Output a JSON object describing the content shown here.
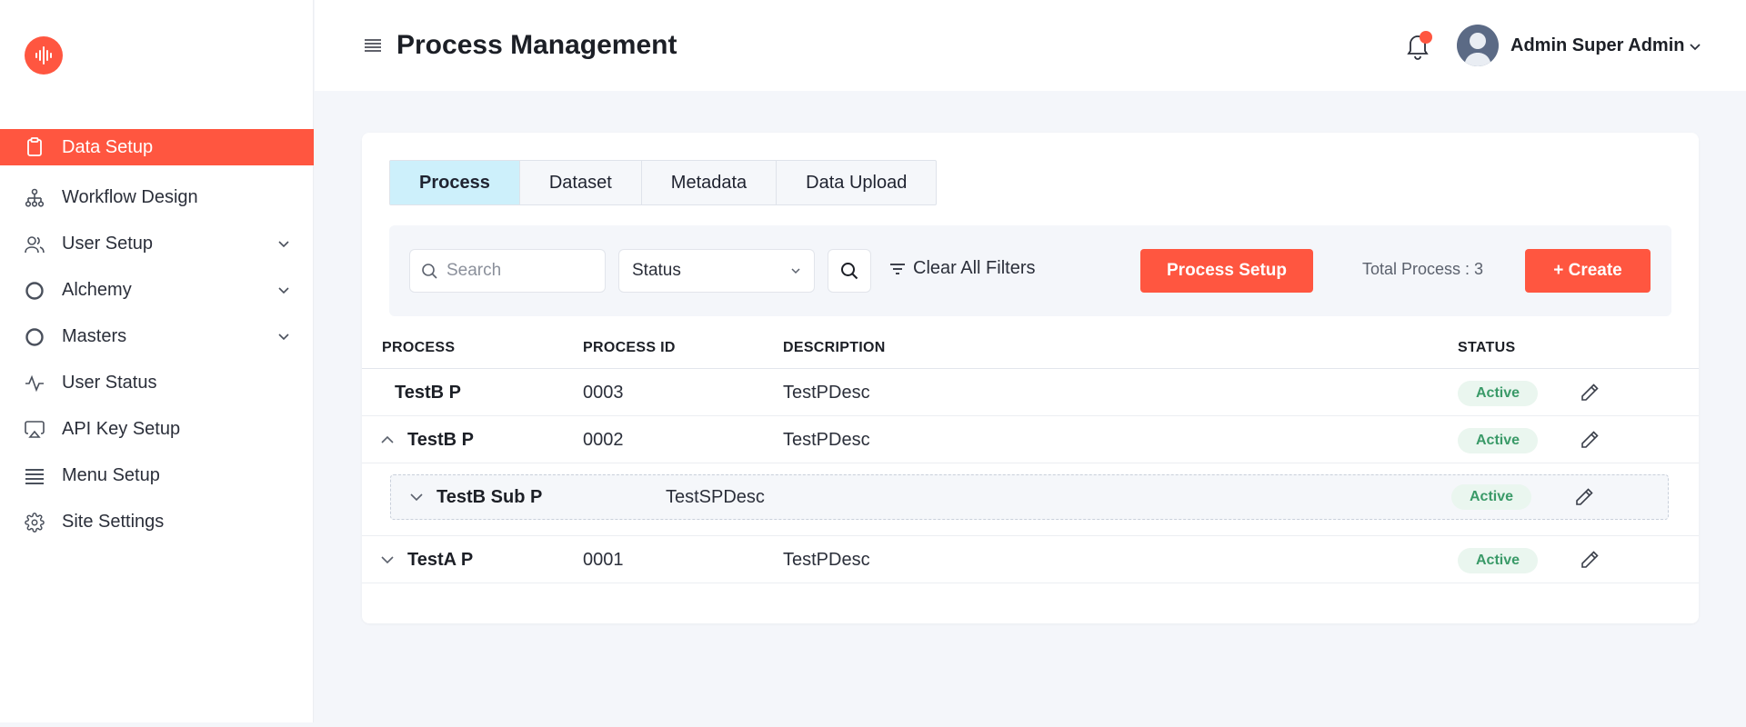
{
  "sidebar": {
    "items": [
      {
        "label": "Data Setup",
        "icon": "clipboard-icon",
        "active": true,
        "has_children": false
      },
      {
        "label": "Workflow Design",
        "icon": "hierarchy-icon",
        "active": false,
        "has_children": false
      },
      {
        "label": "User Setup",
        "icon": "users-icon",
        "active": false,
        "has_children": true
      },
      {
        "label": "Alchemy",
        "icon": "circle-icon",
        "active": false,
        "has_children": true
      },
      {
        "label": "Masters",
        "icon": "circle-icon",
        "active": false,
        "has_children": true
      },
      {
        "label": "User Status",
        "icon": "activity-icon",
        "active": false,
        "has_children": false
      },
      {
        "label": "API Key Setup",
        "icon": "airplay-icon",
        "active": false,
        "has_children": false
      },
      {
        "label": "Menu Setup",
        "icon": "list-icon",
        "active": false,
        "has_children": false
      },
      {
        "label": "Site Settings",
        "icon": "gear-icon",
        "active": false,
        "has_children": false
      }
    ]
  },
  "header": {
    "title": "Process Management",
    "user_name": "Admin Super Admin"
  },
  "tabs": [
    {
      "label": "Process",
      "active": true
    },
    {
      "label": "Dataset",
      "active": false
    },
    {
      "label": "Metadata",
      "active": false
    },
    {
      "label": "Data Upload",
      "active": false
    }
  ],
  "filters": {
    "search_placeholder": "Search",
    "search_value": "",
    "status_selected": "Status",
    "clear_label": "Clear All Filters",
    "process_setup_label": "Process Setup",
    "total_label": "Total Process : 3",
    "create_label": "+ Create"
  },
  "table": {
    "columns": [
      "PROCESS",
      "PROCESS ID",
      "DESCRIPTION",
      "STATUS"
    ],
    "rows": [
      {
        "process": "TestB P",
        "process_id": "0003",
        "description": "TestPDesc",
        "status": "Active"
      },
      {
        "process": "TestB P",
        "process_id": "0002",
        "description": "TestPDesc",
        "status": "Active"
      },
      {
        "process": "TestA P",
        "process_id": "0001",
        "description": "TestPDesc",
        "status": "Active"
      }
    ],
    "subrow": {
      "process": "TestB Sub P",
      "description": "TestSPDesc",
      "status": "Active"
    }
  },
  "colors": {
    "accent": "#ff5640",
    "tab_active_bg": "#cdf0fb",
    "badge_bg": "#eaf6ef",
    "badge_text": "#3a9a68",
    "page_bg": "#f4f6fa"
  }
}
